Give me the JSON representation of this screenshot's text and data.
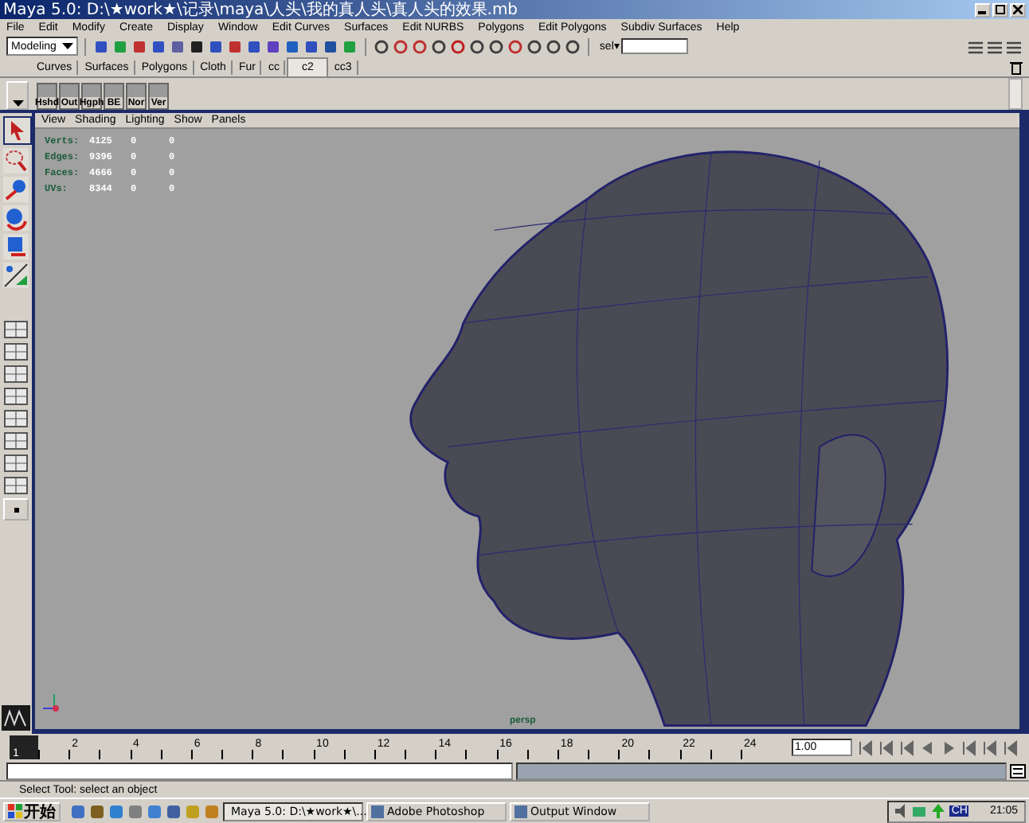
{
  "window": {
    "title": "Maya 5.0: D:\\★work★\\记录\\maya\\人头\\我的真人头\\真人头的效果.mb"
  },
  "menu": [
    "File",
    "Edit",
    "Modify",
    "Create",
    "Display",
    "Window",
    "Edit Curves",
    "Surfaces",
    "Edit NURBS",
    "Polygons",
    "Edit Polygons",
    "Subdiv Surfaces",
    "Help"
  ],
  "status_line": {
    "mode": "Modeling",
    "sel_label": "sel▾"
  },
  "shelf_tabs": [
    {
      "label": "Curves",
      "selected": false
    },
    {
      "label": "Surfaces",
      "selected": false
    },
    {
      "label": "Polygons",
      "selected": false
    },
    {
      "label": "Cloth",
      "selected": false
    },
    {
      "label": "Fur",
      "selected": false
    },
    {
      "label": "cc",
      "selected": false
    },
    {
      "label": "c2",
      "selected": true
    },
    {
      "label": "cc3",
      "selected": false
    }
  ],
  "shelf_buttons": [
    "Hshd",
    "Out",
    "Hgph",
    "BE",
    "Nor",
    "Ver"
  ],
  "panel_menu": [
    "View",
    "Shading",
    "Lighting",
    "Show",
    "Panels"
  ],
  "hud": [
    {
      "label": "Verts:",
      "values": [
        "4125",
        "0",
        "0"
      ]
    },
    {
      "label": "Edges:",
      "values": [
        "9396",
        "0",
        "0"
      ]
    },
    {
      "label": "Faces:",
      "values": [
        "4666",
        "0",
        "0"
      ]
    },
    {
      "label": "UVs:",
      "values": [
        "8344",
        "0",
        "0"
      ]
    }
  ],
  "camera_label": "persp",
  "time_slider": {
    "current": "1",
    "level": 0,
    "labels": [
      "2",
      "4",
      "6",
      "8",
      "10",
      "12",
      "14",
      "16",
      "18",
      "20",
      "22",
      "24"
    ],
    "frame_field": "1.00"
  },
  "help_line": "Select Tool: select an object",
  "taskbar": {
    "start": "开始",
    "tasks": [
      {
        "label": "Maya 5.0: D:\\★work★\\...",
        "selected": true
      },
      {
        "label": "Adobe Photoshop",
        "selected": false
      },
      {
        "label": "Output Window",
        "selected": false
      }
    ],
    "ime": "CH",
    "clock": "21:05"
  }
}
